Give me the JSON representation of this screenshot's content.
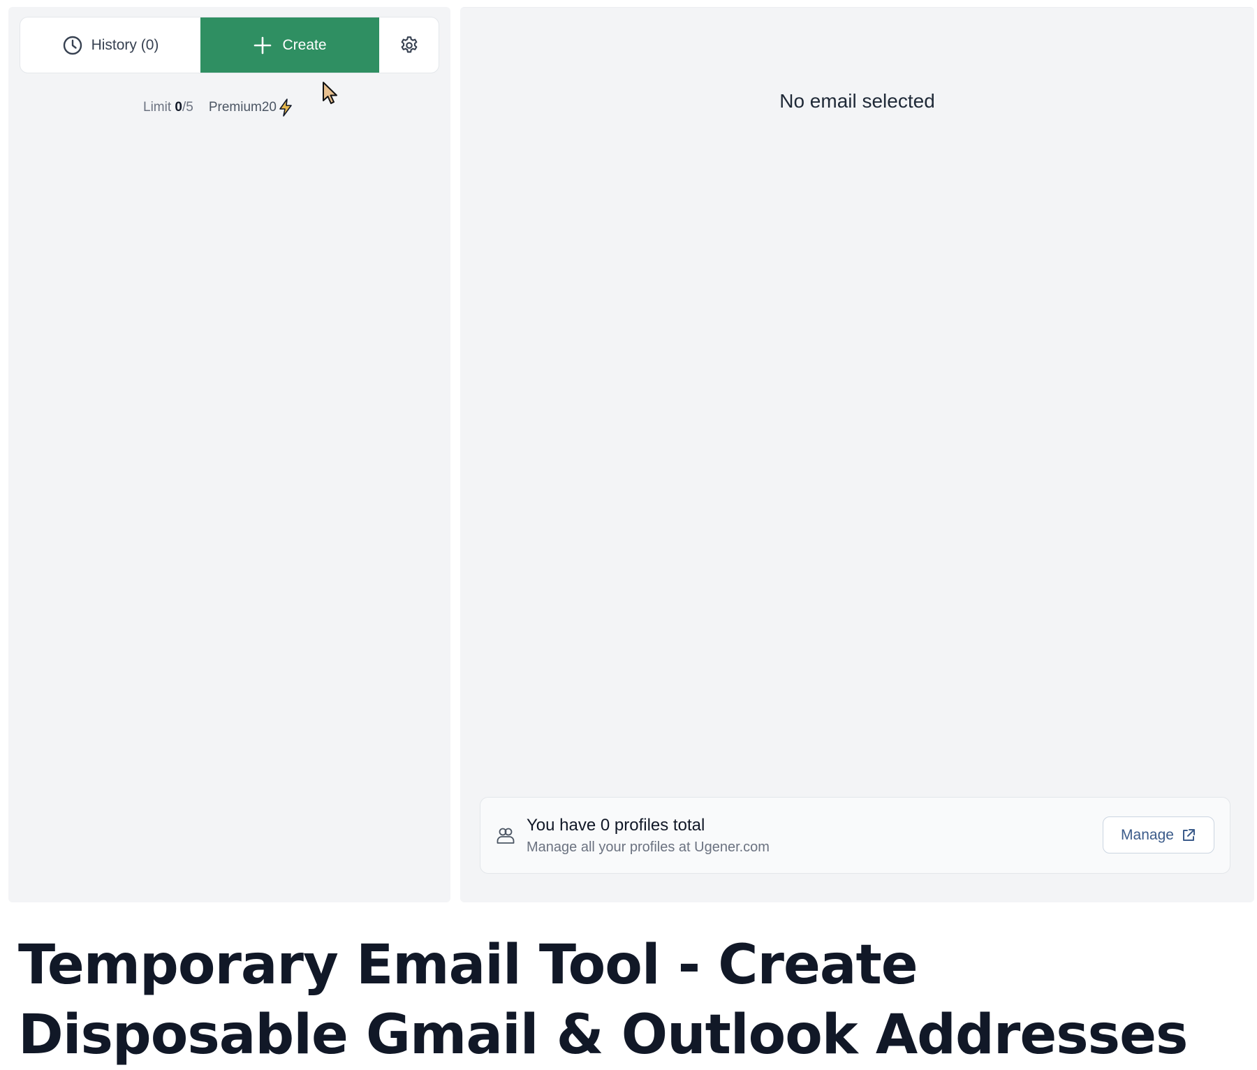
{
  "sidebar": {
    "history_label": "History (0)",
    "create_label": "Create",
    "limit": {
      "prefix": "Limit",
      "used": "0",
      "total": "/5"
    },
    "premium_label": "Premium20"
  },
  "main": {
    "empty_state": "No email selected",
    "profiles": {
      "title": "You have 0 profiles total",
      "subtitle": "Manage all your profiles at Ugener.com",
      "manage_label": "Manage"
    }
  },
  "headline": "Temporary Email Tool - Create Disposable Gmail & Outlook Addresses",
  "icons": {
    "history": "clock-icon",
    "create": "plus-icon",
    "settings": "gear-icon",
    "premium": "lightning-icon",
    "profiles": "users-icon",
    "manage": "external-link-icon"
  },
  "colors": {
    "accent_green": "#2f8f62",
    "panel_bg": "#f3f4f6",
    "manage_text": "#3b5b8a",
    "lightning": "#e7b84e"
  }
}
